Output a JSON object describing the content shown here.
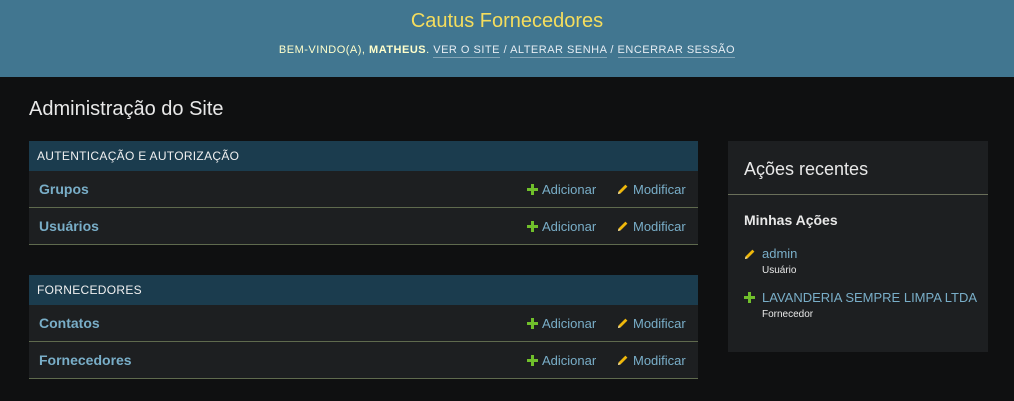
{
  "header": {
    "site_name": "Cautus Fornecedores",
    "welcome": "Bem-vindo(a),",
    "username": "Matheus",
    "view_site": "Ver o site",
    "change_password": "Alterar senha",
    "logout": "Encerrar sessão",
    "separator": "/"
  },
  "page_title": "Administração do Site",
  "apps": [
    {
      "caption": "Autenticação e Autorização",
      "models": [
        {
          "name": "Grupos",
          "add": "Adicionar",
          "change": "Modificar"
        },
        {
          "name": "Usuários",
          "add": "Adicionar",
          "change": "Modificar"
        }
      ]
    },
    {
      "caption": "Fornecedores",
      "models": [
        {
          "name": "Contatos",
          "add": "Adicionar",
          "change": "Modificar"
        },
        {
          "name": "Fornecedores",
          "add": "Adicionar",
          "change": "Modificar"
        }
      ]
    }
  ],
  "recent": {
    "title": "Ações recentes",
    "subtitle": "Minhas Ações",
    "items": [
      {
        "icon": "pencil-icon",
        "label": "admin",
        "type": "Usuário"
      },
      {
        "icon": "plus-icon",
        "label": "LAVANDERIA SEMPRE LIMPA LTDA",
        "type": "Fornecedor"
      }
    ]
  },
  "colors": {
    "header_bg": "#417690",
    "brand": "#f5dd5d",
    "link": "#79aec8",
    "caption_bg": "#1b3c4e",
    "add_icon": "#70bf2b",
    "change_icon": "#efb80b"
  }
}
